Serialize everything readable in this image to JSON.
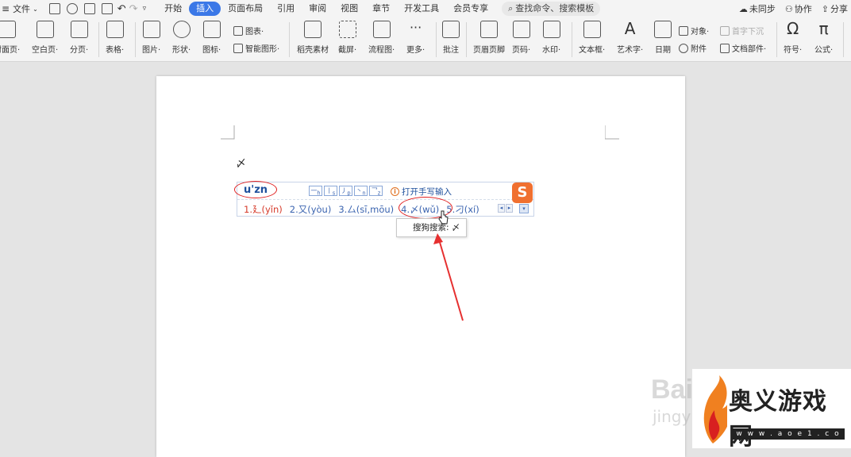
{
  "menubar": {
    "file_label": "文件",
    "tabs": [
      "开始",
      "插入",
      "页面布局",
      "引用",
      "审阅",
      "视图",
      "章节",
      "开发工具",
      "会员专享"
    ],
    "active_tab": "插入",
    "search_placeholder": "查找命令、搜索模板",
    "sync_label": "未同步",
    "collab_label": "协作",
    "share_label": "分享"
  },
  "ribbon": {
    "items": [
      {
        "label": "封面页·"
      },
      {
        "label": "空白页·"
      },
      {
        "label": "分页·"
      },
      {
        "label": "表格·"
      },
      {
        "label": "图片·"
      },
      {
        "label": "形状·"
      },
      {
        "label": "图标·"
      },
      {
        "label": "稻壳素材"
      },
      {
        "label": "截屏·"
      },
      {
        "label": "流程图·"
      },
      {
        "label": "更多·"
      },
      {
        "label": "批注"
      },
      {
        "label": "页眉页脚"
      },
      {
        "label": "页码·"
      },
      {
        "label": "水印·"
      },
      {
        "label": "文本框·"
      },
      {
        "label": "艺术字·"
      },
      {
        "label": "日期"
      },
      {
        "label": "符号·"
      },
      {
        "label": "公式·"
      }
    ],
    "chart_label": "图表·",
    "smart_shape_label": "智能图形·",
    "object_label": "对象·",
    "dropcap_label": "首字下沉",
    "attachment_label": "附件",
    "doc_parts_label": "文档部件·"
  },
  "document": {
    "typed_char": "〆"
  },
  "ime": {
    "composition": "u'zn",
    "tones": [
      "一",
      "丨",
      "丿",
      "丶",
      "乛"
    ],
    "tone_subs": [
      "h",
      "s",
      "p",
      "n",
      "z"
    ],
    "handwrite_label": "打开手写输入",
    "logo": "S",
    "candidates": [
      "1.廴(yǐn)",
      "2.又(yòu)",
      "3.厶(sī,mōu)",
      "4.〆(wǔ)",
      "5.刁(xí)"
    ],
    "tooltip": "搜狗搜索: 〆"
  },
  "watermark": {
    "title": "奥义游戏网",
    "url": "w w w . a o e 1 . c o m",
    "baidu": "Bai",
    "baidu_sub": "jingy"
  },
  "colors": {
    "accent": "#3b78e7",
    "highlight_red": "#e02020",
    "ime_blue": "#1d4f9c"
  }
}
